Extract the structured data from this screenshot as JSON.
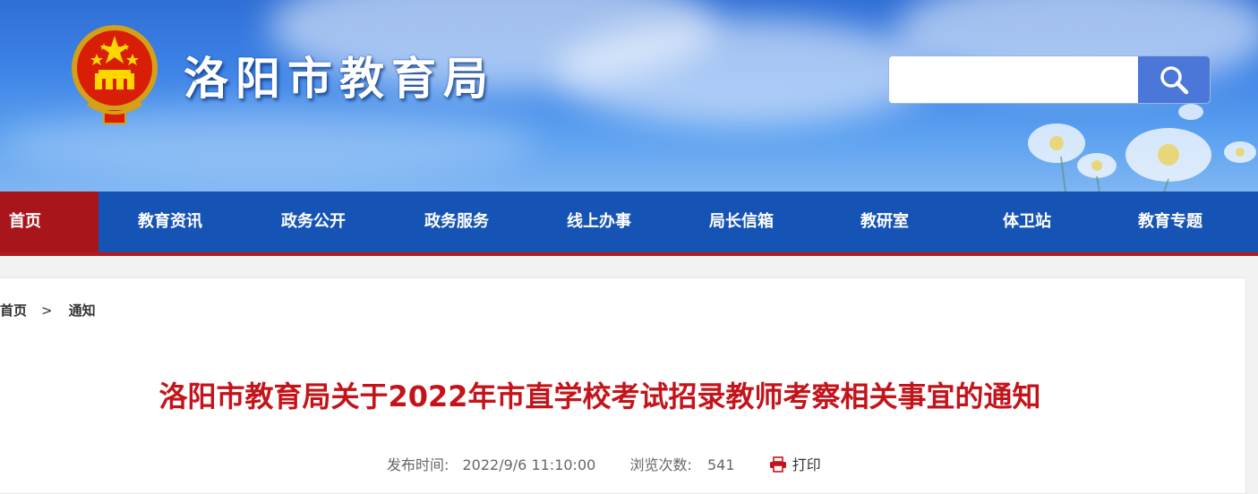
{
  "header": {
    "site_title": "洛阳市教育局",
    "search": {
      "placeholder": ""
    }
  },
  "nav": {
    "items": [
      {
        "label": "首页",
        "active": true
      },
      {
        "label": "教育资讯"
      },
      {
        "label": "政务公开"
      },
      {
        "label": "政务服务"
      },
      {
        "label": "线上办事"
      },
      {
        "label": "局长信箱"
      },
      {
        "label": "教研室"
      },
      {
        "label": "体卫站"
      },
      {
        "label": "教育专题"
      }
    ]
  },
  "breadcrumb": {
    "home": "首页",
    "separator": ">",
    "current": "通知"
  },
  "article": {
    "title": "洛阳市教育局关于2022年市直学校考试招录教师考察相关事宜的通知",
    "publish_label": "发布时间:",
    "publish_time": "2022/9/6 11:10:00",
    "views_label": "浏览次数:",
    "views": "541",
    "print_label": "打印"
  },
  "colors": {
    "nav_bg": "#1553b5",
    "nav_active": "#a8161c",
    "title_red": "#c4141b"
  },
  "icons": [
    "national-emblem",
    "search-icon",
    "print-icon"
  ]
}
